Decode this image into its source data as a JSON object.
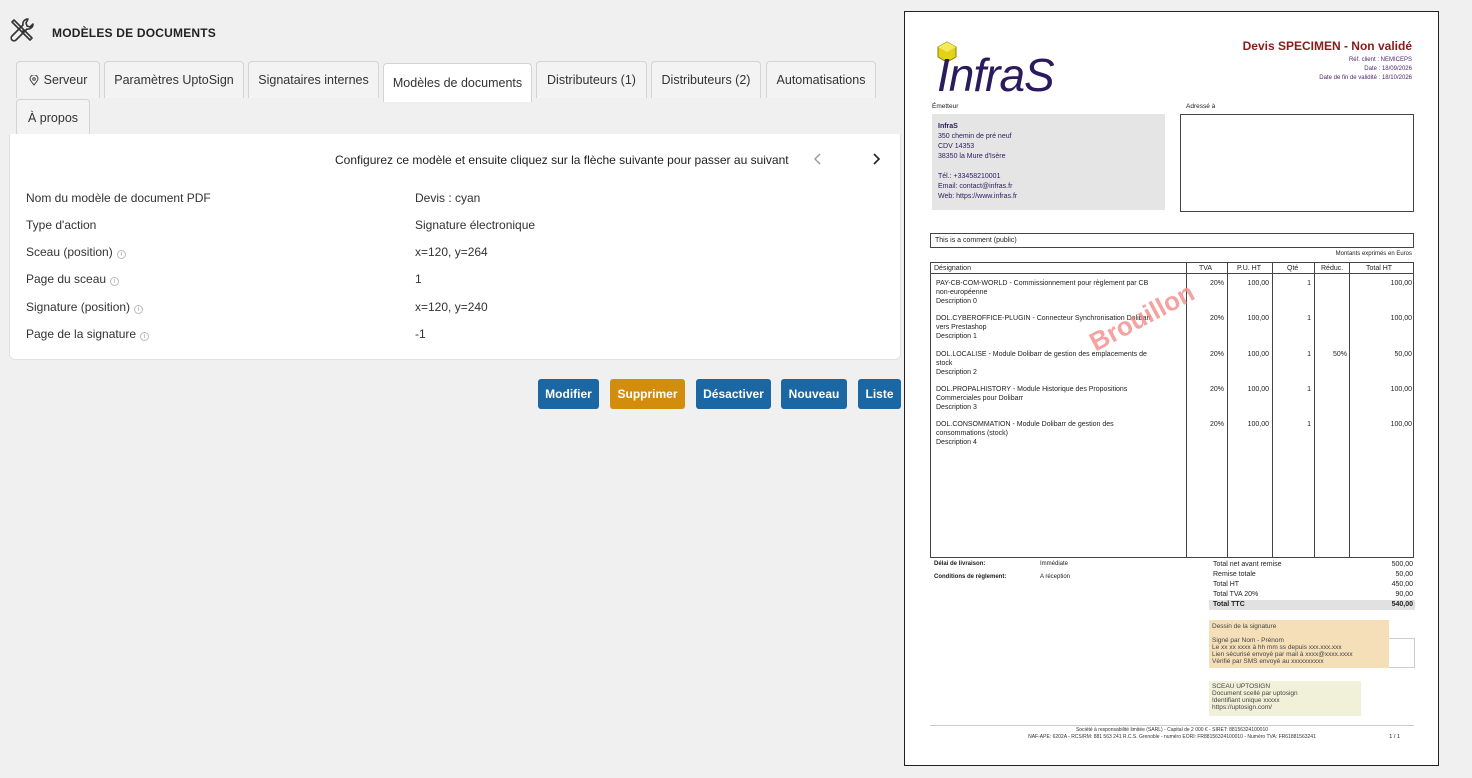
{
  "header": {
    "title": "MODÈLES DE DOCUMENTS",
    "icon": "tools-icon"
  },
  "tabs": [
    {
      "label": "Serveur",
      "icon": "map-pin-icon"
    },
    {
      "label": "Paramètres UptoSign"
    },
    {
      "label": "Signataires internes"
    },
    {
      "label": "Modèles de documents",
      "active": true
    },
    {
      "label": "Distributeurs (1)"
    },
    {
      "label": "Distributeurs (2)"
    },
    {
      "label": "Automatisations"
    },
    {
      "label": "À propos"
    }
  ],
  "card": {
    "instruction": "Configurez ce modèle et ensuite cliquez sur la flèche suivante pour passer au suivant",
    "rows": [
      {
        "label": "Nom du modèle de document PDF",
        "value": "Devis : cyan",
        "info": false
      },
      {
        "label": "Type d'action",
        "value": "Signature électronique",
        "info": false
      },
      {
        "label": "Sceau (position)",
        "value": "x=120, y=264",
        "info": true
      },
      {
        "label": "Page du sceau",
        "value": "1",
        "info": true
      },
      {
        "label": "Signature (position)",
        "value": "x=120, y=240",
        "info": true
      },
      {
        "label": "Page de la signature",
        "value": "-1",
        "info": true
      }
    ]
  },
  "buttons": {
    "modify": "Modifier",
    "delete": "Supprimer",
    "deactivate": "Désactiver",
    "new": "Nouveau",
    "list": "Liste"
  },
  "colors": {
    "primary": "#1a67a3",
    "danger": "#d38d0c",
    "brand_dark": "#2b1a5c",
    "doc_title": "#8b1a1a"
  },
  "pdf": {
    "logo": "InfraS",
    "title": "Devis SPECIMEN - Non validé",
    "ref": "Réf. client : NEMICEPS",
    "date": "Date : 18/09/2026",
    "validity": "Date de fin de validité : 18/10/2026",
    "emitter_label": "Émetteur",
    "address_label": "Adressé à",
    "emitter": {
      "name": "InfraS",
      "street": "350 chemin de pré neuf",
      "cdv": "CDV 14353",
      "city": "38350 la Mure d'Isère",
      "phone": "Tél.: +33458210001",
      "email": "Email: contact@infras.fr",
      "web": "Web: https://www.infras.fr"
    },
    "comment": "This is a comment (public)",
    "amounts_note": "Montants exprimés en Euros",
    "columns": {
      "designation": "Désignation",
      "tva": "TVA",
      "pu": "P.U. HT",
      "qty": "Qté",
      "reduc": "Réduc.",
      "total": "Total HT"
    },
    "items": [
      {
        "title": "PAY-CB-COM-WORLD - Commissionnement pour règlement par CB",
        "title2": "non-européenne",
        "desc": "Description 0",
        "tva": "20%",
        "pu": "100,00",
        "qty": "1",
        "reduc": "",
        "total": "100,00"
      },
      {
        "title": "DOL.CYBEROFFICE-PLUGIN - Connecteur Synchronisation Dolibarr",
        "title2": "vers Prestashop",
        "desc": "Description 1",
        "tva": "20%",
        "pu": "100,00",
        "qty": "1",
        "reduc": "",
        "total": "100,00"
      },
      {
        "title": "DOL.LOCALISE - Module Dolibarr de gestion des emplacements de",
        "title2": "stock",
        "desc": "Description 2",
        "tva": "20%",
        "pu": "100,00",
        "qty": "1",
        "reduc": "50%",
        "total": "50,00"
      },
      {
        "title": "DOL.PROPALHISTORY - Module Historique des Propositions",
        "title2": "Commerciales pour Dolibarr",
        "desc": "Description 3",
        "tva": "20%",
        "pu": "100,00",
        "qty": "1",
        "reduc": "",
        "total": "100,00"
      },
      {
        "title": "DOL.CONSOMMATION - Module Dolibarr de gestion des",
        "title2": "consommations (stock)",
        "desc": "Description 4",
        "tva": "20%",
        "pu": "100,00",
        "qty": "1",
        "reduc": "",
        "total": "100,00"
      }
    ],
    "watermark": "Brouillon",
    "delivery_label": "Délai de livraison:",
    "delivery_value": "Immédiate",
    "payment_label": "Conditions de règlement:",
    "payment_value": "A réception",
    "totals": [
      {
        "label": "Total net avant remise",
        "value": "500,00"
      },
      {
        "label": "Remise totale",
        "value": "50,00"
      },
      {
        "label": "Total HT",
        "value": "450,00"
      },
      {
        "label": "Total TVA 20%",
        "value": "90,00"
      },
      {
        "label": "Total TTC",
        "value": "540,00"
      }
    ],
    "signature": {
      "title": "Dessin de la signature",
      "line1": "Signé par Nom - Prénom",
      "line2": "Le xx xx xxxx à hh mm ss depuis xxx.xxx.xxx",
      "line3": "Lien sécurisé envoyé par mail à xxxx@xxxx.xxxx",
      "line4": "Vérifié par SMS envoyé au xxxxxxxxxx"
    },
    "seal": {
      "title": "SCEAU UPTOSIGN",
      "line1": "Document scellé par uptosign",
      "line2": "Identifiant unique xxxxx",
      "line3": "https://uptosign.com/"
    },
    "footer1": "Société à responsabilité limitée (SARL) - Capital de 2 000 € - SIRET: 88156324100010",
    "footer2": "NAF-APE: 6202A - RCS/RM: 881 563 241 R.C.S. Grenoble - numéro EORI: FR88156324100010 - Numéro TVA: FR61881563241",
    "page": "1 / 1"
  }
}
